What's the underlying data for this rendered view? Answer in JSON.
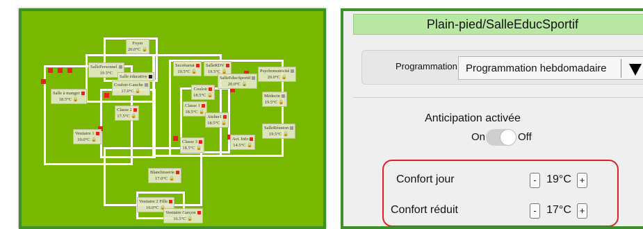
{
  "floor_plan": {
    "rooms": [
      {
        "name": "Foyer",
        "temp": "20.0°C",
        "icon": "lock"
      },
      {
        "name": "SallePersonnel",
        "temp": "19.5°C",
        "icon": "lock"
      },
      {
        "name": "Salle éducative",
        "temp": "",
        "icon": "lock"
      },
      {
        "name": "Couloir-Gauche",
        "temp": "17.0°C",
        "icon": "lock"
      },
      {
        "name": "Salle à manger",
        "temp": "18.5°C",
        "icon": "lock"
      },
      {
        "name": "Classe 2",
        "temp": "17.5°C",
        "icon": "lock"
      },
      {
        "name": "Vestiaire 1",
        "temp": "19.0°C",
        "icon": "lock"
      },
      {
        "name": "Secrétariat",
        "temp": "19.5°C",
        "icon": "lock"
      },
      {
        "name": "SalleRDV",
        "temp": "19.5°C",
        "icon": "lock"
      },
      {
        "name": "SalleEducSportif",
        "temp": "20.0°C",
        "icon": "lock"
      },
      {
        "name": "Psychomotricité",
        "temp": "20.0°C",
        "icon": "lock"
      },
      {
        "name": "Couloir",
        "temp": "18.5°C",
        "icon": "lock"
      },
      {
        "name": "Classe 1",
        "temp": "18.5°C",
        "icon": "lock"
      },
      {
        "name": "Atelier1",
        "temp": "18.5°C",
        "icon": "lock"
      },
      {
        "name": "Médecin",
        "temp": "19.5°C",
        "icon": "lock"
      },
      {
        "name": "SalleRéunion",
        "temp": "19.5°C",
        "icon": "lock"
      },
      {
        "name": "Act. Info",
        "temp": "14.5°C",
        "icon": "lock"
      },
      {
        "name": "Classe 3",
        "temp": "18.5°C",
        "icon": "lock"
      },
      {
        "name": "Blanchisserie",
        "temp": "17.0°C",
        "icon": "lock"
      },
      {
        "name": "Vestiaire 2 Fille",
        "temp": "16.0°C",
        "icon": "lock"
      },
      {
        "name": "Vestiaire Garçon",
        "temp": "16.5°C",
        "icon": "lock"
      }
    ]
  },
  "panel": {
    "title": "Plain-pied/SalleEducSportif",
    "programmation_label": "Programmation",
    "programmation_value": "Programmation hebdomadaire",
    "anticipation_label": "Anticipation activée",
    "toggle_on": "On",
    "toggle_off": "Off",
    "toggle_state": "off",
    "confort_jour_label": "Confort jour",
    "confort_jour_value": "19°C",
    "confort_reduit_label": "Confort réduit",
    "confort_reduit_value": "17°C",
    "minus": "-",
    "plus": "+"
  },
  "colors": {
    "plan_background": "#79b800",
    "title_bar": "#b8e7a3",
    "highlight_border": "#e01f2a",
    "heater_marker": "#e4231b"
  }
}
